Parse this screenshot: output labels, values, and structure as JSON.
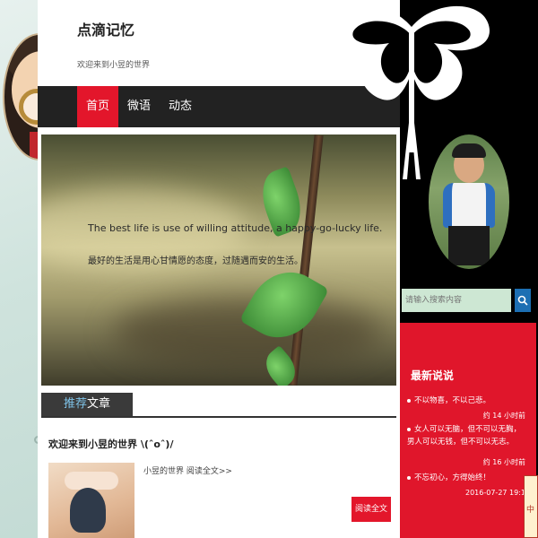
{
  "site": {
    "title": "点滴记忆",
    "subtitle": "欢迎来到小昱的世界"
  },
  "nav": {
    "items": [
      {
        "label": "首页",
        "active": true
      },
      {
        "label": "微语",
        "active": false
      },
      {
        "label": "动态",
        "active": false
      }
    ]
  },
  "banner": {
    "quote_en": "The best life is use of willing attitude, a happy-go-lucky life.",
    "quote_cn": "最好的生活是用心甘情愿的态度，过随遇而安的生活。"
  },
  "section": {
    "tab_highlight": "推荐",
    "tab_rest": "文章"
  },
  "post": {
    "title": "欢迎来到小昱的世界 \\(ˆoˆ)/",
    "excerpt": "小昱的世界 阅读全文>>",
    "read_more": "阅读全文>>"
  },
  "sidebar": {
    "search_placeholder": "请输入搜索内容",
    "latest_title": "最新说说",
    "latest": [
      {
        "text": "不以物喜，不以己悲。",
        "time": "约 14 小时前"
      },
      {
        "text": "女人可以无脑，但不可以无胸， 男人可以无钱，但不可以无志。",
        "time": "约 16 小时前"
      },
      {
        "text": "不忘初心，方得始终！",
        "time": "2016-07-27 19:1"
      }
    ]
  },
  "decor": {
    "scroll_char": "中"
  },
  "colors": {
    "accent_red": "#e3162b",
    "nav_bg": "#222222",
    "search_button": "#1c6fb3"
  }
}
